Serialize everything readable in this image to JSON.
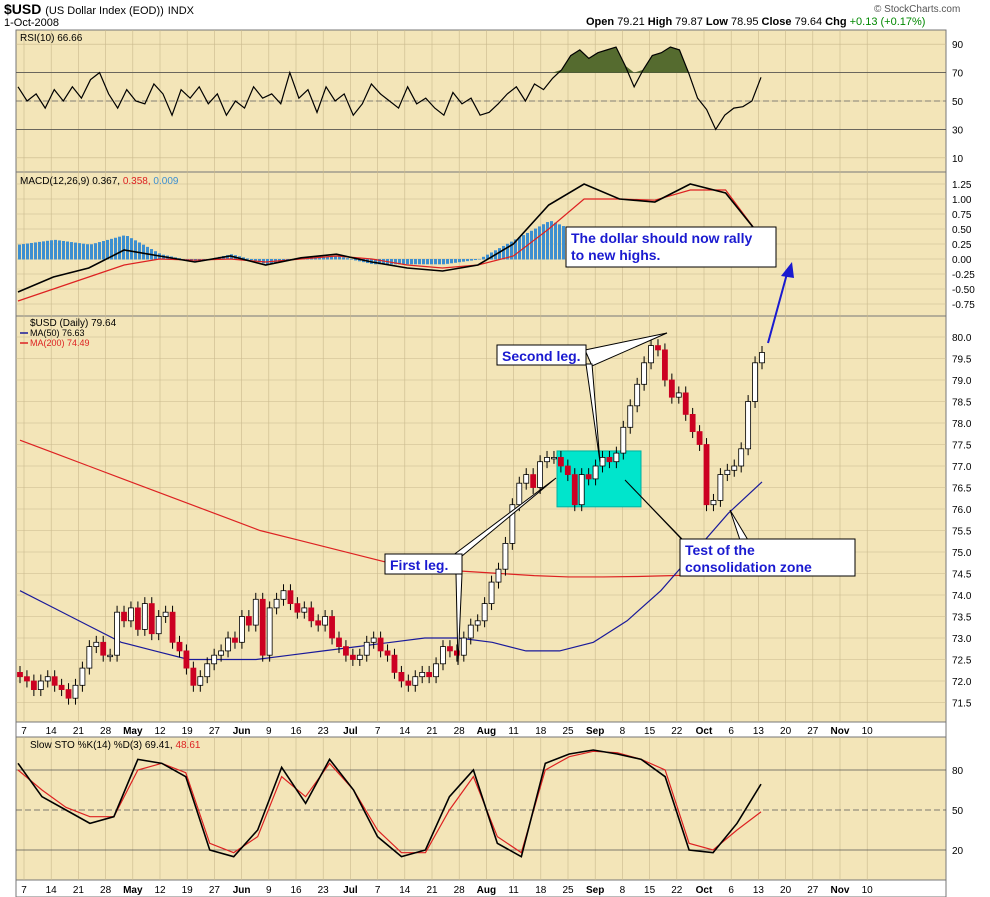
{
  "header": {
    "symbol": "$USD",
    "description": "(US Dollar Index (EOD))",
    "exchange": "INDX",
    "date": "1-Oct-2008",
    "open_label": "Open",
    "open": "79.21",
    "high_label": "High",
    "high": "79.87",
    "low_label": "Low",
    "low": "78.95",
    "close_label": "Close",
    "close": "79.64",
    "chg_label": "Chg",
    "chg": "+0.13 (+0.17%)",
    "brand": "© StockCharts.com",
    "chg_color": "#008800"
  },
  "colors": {
    "panel_bg": "#f3e5b8",
    "price_up": "#ffffff",
    "price_down": "#cc0022",
    "ma50": "#1a1a9a",
    "ma200": "#dd2222",
    "rsi_fill": "#556b2f",
    "macd_hist": "#3d8fd0",
    "consolidation": "#00e5cc",
    "arrow": "#1a1ad0"
  },
  "panels": {
    "rsi": {
      "label": "RSI(10) 66.66",
      "ticks": [
        "90",
        "70",
        "50",
        "30",
        "10"
      ]
    },
    "macd": {
      "label_main": "MACD(12,26,9) 0.367,",
      "label_signal": "0.358,",
      "label_hist": "0.009",
      "ticks": [
        "1.25",
        "1.00",
        "0.75",
        "0.50",
        "0.25",
        "0.00",
        "-0.25",
        "-0.50",
        "-0.75"
      ]
    },
    "price": {
      "label_main": "$USD (Daily) 79.64",
      "label_ma50": "MA(50) 76.63",
      "label_ma200": "MA(200) 74.49",
      "ticks": [
        "80.0",
        "79.5",
        "79.0",
        "78.5",
        "78.0",
        "77.5",
        "77.0",
        "76.5",
        "76.0",
        "75.5",
        "75.0",
        "74.5",
        "74.0",
        "73.5",
        "73.0",
        "72.5",
        "72.0",
        "71.5"
      ]
    },
    "sto": {
      "label_main": "Slow STO %K(14) %D(3) 69.41,",
      "label_d": "48.61",
      "ticks": [
        "80",
        "50",
        "20"
      ]
    }
  },
  "xaxis_labels": [
    "7",
    "14",
    "21",
    "28",
    "May",
    "12",
    "19",
    "27",
    "Jun",
    "9",
    "16",
    "23",
    "Jul",
    "7",
    "14",
    "21",
    "28",
    "Aug",
    "11",
    "18",
    "25",
    "Sep",
    "8",
    "15",
    "22",
    "Oct",
    "6",
    "13",
    "20",
    "27",
    "Nov",
    "10"
  ],
  "annotations": {
    "first_leg": "First leg.",
    "second_leg": "Second leg.",
    "test_line1": "Test of the",
    "test_line2": "consolidation zone",
    "rally_line1": "The dollar should now rally",
    "rally_line2": "to new highs."
  },
  "chart_data": {
    "type": "line",
    "title": "$USD (US Dollar Index (EOD)) INDX",
    "xlabel": "",
    "ylabel": "",
    "ylim": [
      71.2,
      80.4
    ],
    "series": [
      {
        "name": "$USD (Daily)",
        "values": [
          72.1,
          72.0,
          71.8,
          72.0,
          72.1,
          71.9,
          71.8,
          71.6,
          71.9,
          72.3,
          72.8,
          72.9,
          72.6,
          72.6,
          73.6,
          73.4,
          73.7,
          73.2,
          73.8,
          73.1,
          73.5,
          73.6,
          72.9,
          72.7,
          72.3,
          71.9,
          72.1,
          72.4,
          72.6,
          72.7,
          73.0,
          72.9,
          73.5,
          73.3,
          73.9,
          72.6,
          73.7,
          73.9,
          74.1,
          73.8,
          73.6,
          73.7,
          73.4,
          73.3,
          73.5,
          73.0,
          72.8,
          72.6,
          72.5,
          72.6,
          72.9,
          73.0,
          72.7,
          72.6,
          72.2,
          72.0,
          71.9,
          72.1,
          72.2,
          72.1,
          72.4,
          72.8,
          72.7,
          72.6,
          73.0,
          73.3,
          73.4,
          73.8,
          74.3,
          74.6,
          75.2,
          76.1,
          76.6,
          76.8,
          76.5,
          77.1,
          77.2,
          77.2,
          77.0,
          76.8,
          76.1,
          76.8,
          76.7,
          77.0,
          77.2,
          77.1,
          77.3,
          77.9,
          78.4,
          78.9,
          79.4,
          79.8,
          79.7,
          79.0,
          78.6,
          78.7,
          78.2,
          77.8,
          77.5,
          76.1,
          76.2,
          76.8,
          76.9,
          77.0,
          77.4,
          78.5,
          79.4,
          79.64
        ]
      },
      {
        "name": "MA(50)",
        "values": [
          74.1,
          73.7,
          73.3,
          72.9,
          72.7,
          72.5,
          72.5,
          72.5,
          72.6,
          72.7,
          72.8,
          72.9,
          73.0,
          73.0,
          72.9,
          72.7,
          72.7,
          72.9,
          73.4,
          74.1,
          75.0,
          75.9,
          76.63
        ]
      },
      {
        "name": "MA(200)",
        "values": [
          77.6,
          77.3,
          77.0,
          76.7,
          76.4,
          76.1,
          75.8,
          75.5,
          75.3,
          75.1,
          74.9,
          74.7,
          74.6,
          74.55,
          74.5,
          74.45,
          74.42,
          74.42,
          74.43,
          74.45,
          74.47,
          74.49
        ]
      }
    ],
    "rsi": [
      60,
      50,
      55,
      45,
      58,
      50,
      60,
      52,
      65,
      70,
      55,
      45,
      58,
      50,
      48,
      62,
      55,
      40,
      58,
      52,
      60,
      48,
      55,
      40,
      50,
      45,
      60,
      52,
      55,
      48,
      70,
      52,
      58,
      42,
      60,
      50,
      55,
      40,
      48,
      62,
      55,
      50,
      45,
      60,
      48,
      52,
      45,
      40,
      56,
      48,
      52,
      40,
      42,
      48,
      55,
      60,
      50,
      62,
      58,
      66,
      72,
      82,
      86,
      80,
      84,
      86,
      88,
      75,
      60,
      72,
      82,
      84,
      88,
      86,
      70,
      52,
      44,
      30,
      40,
      45,
      46,
      50,
      66.66
    ],
    "macd": [
      -0.55,
      -0.3,
      -0.15,
      0.15,
      0.05,
      -0.05,
      0.05,
      -0.1,
      0.02,
      0.08,
      -0.05,
      -0.15,
      -0.2,
      -0.1,
      0.25,
      0.9,
      1.25,
      1.0,
      0.95,
      1.25,
      1.1,
      0.367
    ],
    "macd_signal": [
      -0.7,
      -0.5,
      -0.3,
      -0.1,
      0.0,
      -0.02,
      0.0,
      -0.05,
      0.0,
      0.05,
      0.0,
      -0.1,
      -0.15,
      -0.1,
      0.05,
      0.5,
      1.0,
      1.0,
      0.98,
      1.15,
      1.15,
      0.358
    ],
    "stoch_k": [
      85,
      60,
      50,
      40,
      45,
      88,
      85,
      75,
      20,
      15,
      35,
      82,
      55,
      88,
      65,
      30,
      15,
      20,
      60,
      80,
      25,
      15,
      85,
      92,
      95,
      92,
      88,
      75,
      20,
      18,
      40,
      69.41
    ],
    "stoch_d": [
      80,
      65,
      52,
      45,
      45,
      80,
      85,
      78,
      25,
      18,
      30,
      75,
      60,
      85,
      65,
      35,
      18,
      18,
      50,
      75,
      30,
      18,
      80,
      90,
      94,
      93,
      88,
      80,
      25,
      20,
      35,
      48.61
    ]
  }
}
